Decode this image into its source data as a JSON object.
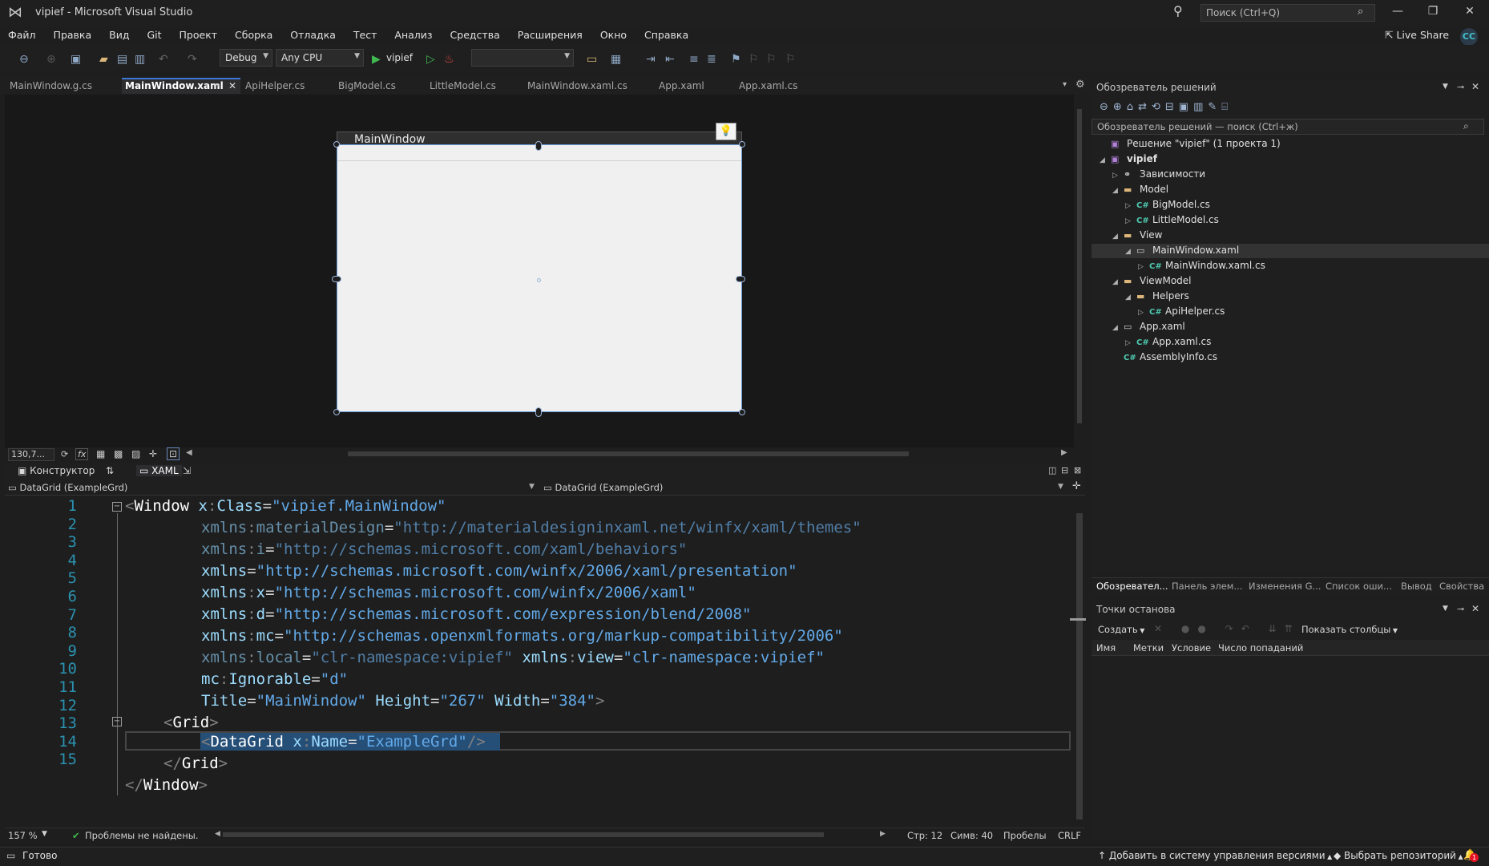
{
  "window": {
    "title": "vipief - Microsoft Visual Studio",
    "search_placeholder": "Поиск (Ctrl+Q)",
    "live_share": "Live Share",
    "avatar": "CC"
  },
  "menu": [
    "Файл",
    "Правка",
    "Вид",
    "Git",
    "Проект",
    "Сборка",
    "Отладка",
    "Тест",
    "Анализ",
    "Средства",
    "Расширения",
    "Окно",
    "Справка"
  ],
  "toolbar": {
    "configuration": "Debug",
    "platform": "Any CPU",
    "run_target": "vipief",
    "empty_dropdown": ""
  },
  "doc_tabs": [
    {
      "label": "MainWindow.g.cs",
      "active": false
    },
    {
      "label": "MainWindow.xaml",
      "active": true
    },
    {
      "label": "ApiHelper.cs",
      "active": false
    },
    {
      "label": "BigModel.cs",
      "active": false
    },
    {
      "label": "LittleModel.cs",
      "active": false
    },
    {
      "label": "MainWindow.xaml.cs",
      "active": false
    },
    {
      "label": "App.xaml",
      "active": false
    },
    {
      "label": "App.xaml.cs",
      "active": false
    }
  ],
  "designer": {
    "window_title": "MainWindow",
    "zoom": "130,7...",
    "fx": "fx"
  },
  "split": {
    "designer_tab": "Конструктор",
    "swap": "⇅",
    "xaml_tab": "XAML"
  },
  "navbar": {
    "left": "DataGrid (ExampleGrd)",
    "right": "DataGrid (ExampleGrd)"
  },
  "code": {
    "line_numbers": [
      "1",
      "2",
      "3",
      "4",
      "5",
      "6",
      "7",
      "8",
      "9",
      "10",
      "11",
      "12",
      "13",
      "14",
      "15"
    ],
    "l1": {
      "open": "<",
      "elem": "Window",
      "attr_prefix": "x",
      "colon": ":",
      "attr": "Class",
      "eq": "=",
      "val": "\"vipief.MainWindow\""
    },
    "l2": {
      "attr": "xmlns",
      "colon": ":",
      "name": "materialDesign",
      "eq": "=",
      "val": "\"http://materialdesigninxaml.net/winfx/xaml/themes\""
    },
    "l3": {
      "attr": "xmlns",
      "colon": ":",
      "name": "i",
      "eq": "=",
      "val": "\"http://schemas.microsoft.com/xaml/behaviors\""
    },
    "l4": {
      "attr": "xmlns",
      "eq": "=",
      "val": "\"http://schemas.microsoft.com/winfx/2006/xaml/presentation\""
    },
    "l5": {
      "attr": "xmlns",
      "colon": ":",
      "name": "x",
      "eq": "=",
      "val": "\"http://schemas.microsoft.com/winfx/2006/xaml\""
    },
    "l6": {
      "attr": "xmlns",
      "colon": ":",
      "name": "d",
      "eq": "=",
      "val": "\"http://schemas.microsoft.com/expression/blend/2008\""
    },
    "l7": {
      "attr": "xmlns",
      "colon": ":",
      "name": "mc",
      "eq": "=",
      "val": "\"http://schemas.openxmlformats.org/markup-compatibility/2006\""
    },
    "l8": {
      "attr": "xmlns",
      "colon": ":",
      "name": "local",
      "eq": "=",
      "val": "\"clr-namespace:vipief\"",
      "attr2": "xmlns",
      "name2": "view",
      "val2": "\"clr-namespace:vipief\""
    },
    "l9": {
      "prefix": "mc",
      "colon": ":",
      "attr": "Ignorable",
      "eq": "=",
      "val": "\"d\""
    },
    "l10": {
      "a1": "Title",
      "v1": "\"MainWindow\"",
      "a2": "Height",
      "v2": "\"267\"",
      "a3": "Width",
      "v3": "\"384\"",
      "close": ">"
    },
    "l11": {
      "open": "<",
      "elem": "Grid",
      "close": ">"
    },
    "l12": {
      "open": "<",
      "elem": "DataGrid",
      "prefix": "x",
      "colon": ":",
      "attr": "Name",
      "eq": "=",
      "val": "\"ExampleGrd\"",
      "close": "/>"
    },
    "l13": {
      "open": "</",
      "elem": "Grid",
      "close": ">"
    },
    "l14": {
      "open": "</",
      "elem": "Window",
      "close": ">"
    }
  },
  "editor_status": {
    "zoom": "157 %",
    "issues": "Проблемы не найдены.",
    "line": "Стр: 12",
    "col": "Симв: 40",
    "spaces": "Пробелы",
    "eol": "CRLF"
  },
  "solution_explorer": {
    "header": "Обозреватель решений",
    "search_placeholder": "Обозреватель решений — поиск (Ctrl+ж)",
    "items": [
      {
        "label": "Решение \"vipief\"  (1 проекта 1)",
        "level": 0,
        "icon": "solution",
        "arrow": ""
      },
      {
        "label": "vipief",
        "level": 0,
        "icon": "project",
        "arrow": "◢"
      },
      {
        "label": "Зависимости",
        "level": 1,
        "icon": "dependencies",
        "arrow": "▷"
      },
      {
        "label": "Model",
        "level": 1,
        "icon": "folder",
        "arrow": "◢"
      },
      {
        "label": "BigModel.cs",
        "level": 2,
        "icon": "cs",
        "arrow": "▷"
      },
      {
        "label": "LittleModel.cs",
        "level": 2,
        "icon": "cs",
        "arrow": "▷"
      },
      {
        "label": "View",
        "level": 1,
        "icon": "folder",
        "arrow": "◢"
      },
      {
        "label": "MainWindow.xaml",
        "level": 2,
        "icon": "xaml",
        "arrow": "◢"
      },
      {
        "label": "MainWindow.xaml.cs",
        "level": 3,
        "icon": "cs",
        "arrow": "▷"
      },
      {
        "label": "ViewModel",
        "level": 1,
        "icon": "folder",
        "arrow": "◢"
      },
      {
        "label": "Helpers",
        "level": 2,
        "icon": "folder",
        "arrow": "◢"
      },
      {
        "label": "ApiHelper.cs",
        "level": 3,
        "icon": "cs",
        "arrow": "▷"
      },
      {
        "label": "App.xaml",
        "level": 1,
        "icon": "xaml",
        "arrow": "◢"
      },
      {
        "label": "App.xaml.cs",
        "level": 2,
        "icon": "cs",
        "arrow": "▷"
      },
      {
        "label": "AssemblyInfo.cs",
        "level": 1,
        "icon": "cs",
        "arrow": ""
      }
    ]
  },
  "panel_tabs": [
    {
      "label": "Обозревател...",
      "active": true
    },
    {
      "label": "Панель элем...",
      "active": false
    },
    {
      "label": "Изменения G...",
      "active": false
    },
    {
      "label": "Список оши...",
      "active": false
    },
    {
      "label": "Вывод",
      "active": false
    },
    {
      "label": "Свойства",
      "active": false
    }
  ],
  "breakpoints": {
    "header": "Точки останова",
    "create": "Создать",
    "show_columns": "Показать столбцы",
    "columns": [
      "Имя",
      "Метки",
      "Условие",
      "Число попаданий"
    ]
  },
  "statusbar": {
    "ready": "Готово",
    "vcs": "Добавить в систему управления версиями",
    "repo": "Выбрать репозиторий",
    "notifications": "1"
  }
}
